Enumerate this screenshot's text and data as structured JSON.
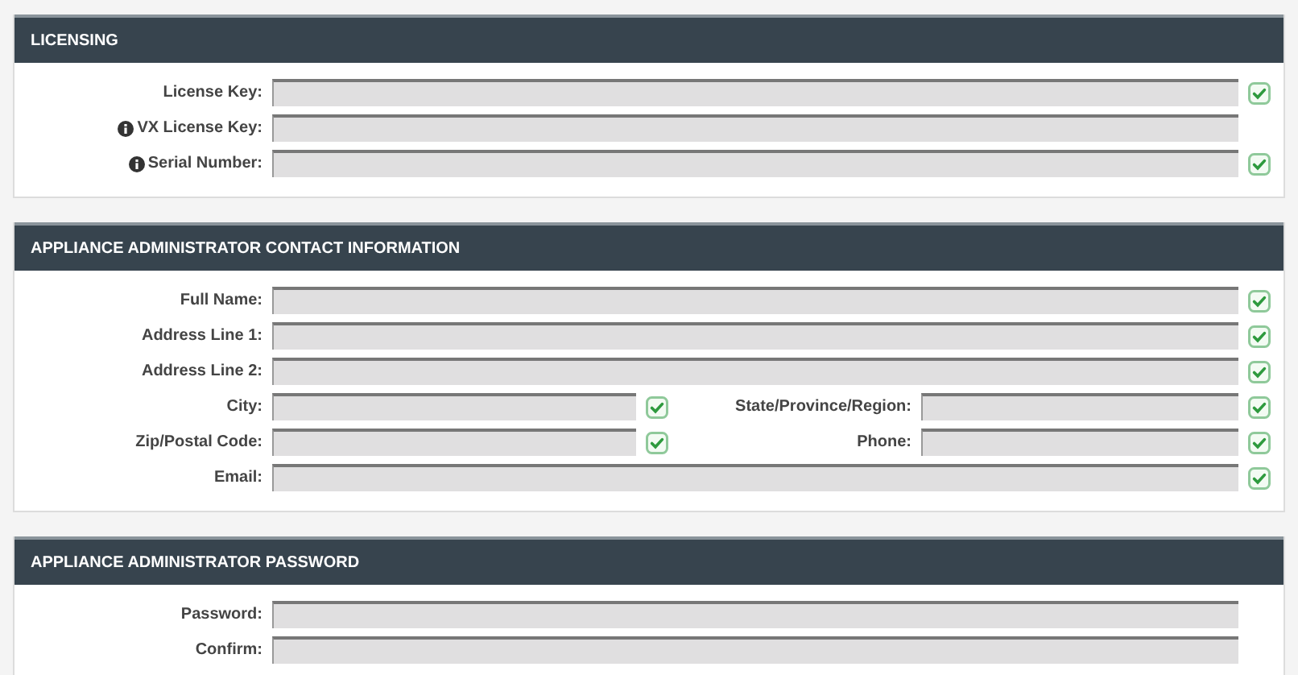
{
  "sections": [
    {
      "title": "LICENSING",
      "rows": [
        [
          {
            "label": "License Key:",
            "info": false,
            "valid": true
          }
        ],
        [
          {
            "label": "VX License Key:",
            "info": true,
            "valid": false
          }
        ],
        [
          {
            "label": "Serial Number:",
            "info": true,
            "valid": true
          }
        ]
      ]
    },
    {
      "title": "APPLIANCE ADMINISTRATOR CONTACT INFORMATION",
      "rows": [
        [
          {
            "label": "Full Name:",
            "info": false,
            "valid": true
          }
        ],
        [
          {
            "label": "Address Line 1:",
            "info": false,
            "valid": true
          }
        ],
        [
          {
            "label": "Address Line 2:",
            "info": false,
            "valid": true
          }
        ],
        [
          {
            "label": "City:",
            "info": false,
            "valid": true
          },
          {
            "label": "State/Province/Region:",
            "info": false,
            "valid": true
          }
        ],
        [
          {
            "label": "Zip/Postal Code:",
            "info": false,
            "valid": true
          },
          {
            "label": "Phone:",
            "info": false,
            "valid": true
          }
        ],
        [
          {
            "label": "Email:",
            "info": false,
            "valid": true
          }
        ]
      ]
    },
    {
      "title": "APPLIANCE ADMINISTRATOR PASSWORD",
      "rows": [
        [
          {
            "label": "Password:",
            "info": false,
            "valid": false
          }
        ],
        [
          {
            "label": "Confirm:",
            "info": false,
            "valid": false
          }
        ]
      ]
    }
  ]
}
